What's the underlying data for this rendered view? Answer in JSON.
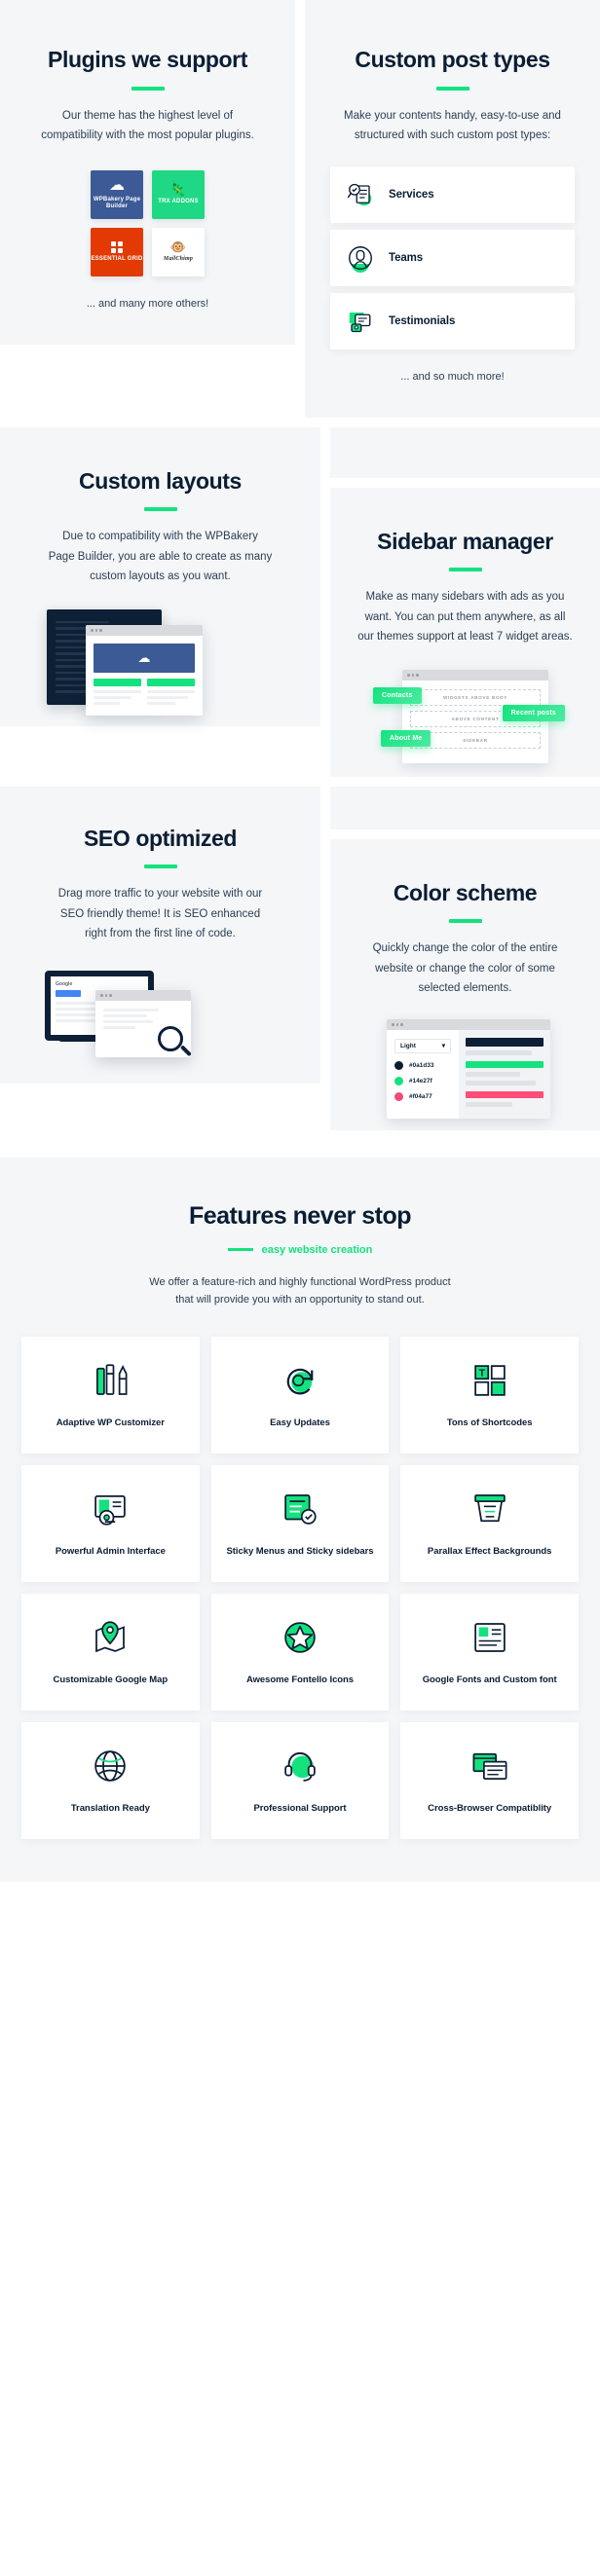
{
  "plugins_section": {
    "title": "Plugins we support",
    "description": "Our theme has the highest level of compatibility with the most popular plugins.",
    "plugins": [
      {
        "name": "WPBakery Page Builder",
        "icon": "wpbakery-logo-icon",
        "bg": "#3c5a96"
      },
      {
        "name": "TRX ADDONS",
        "icon": "trx-dinosaur-icon",
        "bg": "#1ed885"
      },
      {
        "name": "ESSENTIAL GRID",
        "icon": "essential-grid-dots-icon",
        "bg": "#e23a02"
      },
      {
        "name": "MailChimp",
        "icon": "mailchimp-monkey-icon",
        "bg": "#ffffff"
      }
    ],
    "footer_note": "... and many more others!"
  },
  "post_types_section": {
    "title": "Custom post types",
    "description": "Make your contents handy, easy-to-use and structured with such custom post types:",
    "items": [
      {
        "label": "Services",
        "icon": "services-document-search-icon"
      },
      {
        "label": "Teams",
        "icon": "teams-person-circle-icon"
      },
      {
        "label": "Testimonials",
        "icon": "testimonials-speech-bubble-icon"
      }
    ],
    "footer_note": "... and so much more!"
  },
  "custom_layouts_section": {
    "title": "Custom layouts",
    "description": "Due to compatibility with the WPBakery Page Builder, you are able to create as many custom layouts as you want."
  },
  "sidebar_manager_section": {
    "title": "Sidebar manager",
    "description": "Make as many sidebars with ads as you want. You can put them anywhere, as all our themes support at least 7 widget areas.",
    "badges": [
      "Contacts",
      "Recent posts",
      "About Me"
    ],
    "widget_slots": [
      "WIDGETS ABOVE BODY",
      "ABOVE CONTENT",
      "SIDEBAR"
    ]
  },
  "seo_section": {
    "title": "SEO optimized",
    "description": "Drag more traffic to your website with our SEO friendly theme! It is SEO enhanced right from the first line of code.",
    "browser_label": "Google"
  },
  "color_scheme_section": {
    "title": "Color scheme",
    "description": "Quickly change the color of the entire website or change the color of some selected elements.",
    "select_value": "Light",
    "swatches": [
      {
        "hex": "#0a1d33",
        "label": "#0a1d33"
      },
      {
        "hex": "#14e27f",
        "label": "#14e27f"
      },
      {
        "hex": "#f04a77",
        "label": "#f04a77"
      }
    ]
  },
  "features_section": {
    "title": "Features never stop",
    "subtitle": "easy website creation",
    "description": "We offer a feature-rich and highly functional WordPress product that will provide you with an opportunity to stand out.",
    "accent_color": "#14e27f",
    "cards": [
      {
        "label": "Adaptive WP Customizer",
        "icon": "customizer-tools-icon"
      },
      {
        "label": "Easy Updates",
        "icon": "updates-refresh-icon"
      },
      {
        "label": "Tons of Shortcodes",
        "icon": "shortcodes-grid-icon"
      },
      {
        "label": "Powerful Admin Interface",
        "icon": "admin-gear-screen-icon"
      },
      {
        "label": "Sticky Menus and Sticky sidebars",
        "icon": "sticky-menu-check-icon"
      },
      {
        "label": "Parallax Effect Backgrounds",
        "icon": "parallax-layers-icon"
      },
      {
        "label": "Customizable Google Map",
        "icon": "map-pin-icon"
      },
      {
        "label": "Awesome Fontello Icons",
        "icon": "fontello-star-icon"
      },
      {
        "label": "Google Fonts and Custom font",
        "icon": "fonts-typography-icon"
      },
      {
        "label": "Translation Ready",
        "icon": "translation-globe-icon"
      },
      {
        "label": "Professional Support",
        "icon": "support-headset-icon"
      },
      {
        "label": "Cross-Browser Compatiblity",
        "icon": "browsers-windows-icon"
      }
    ]
  }
}
